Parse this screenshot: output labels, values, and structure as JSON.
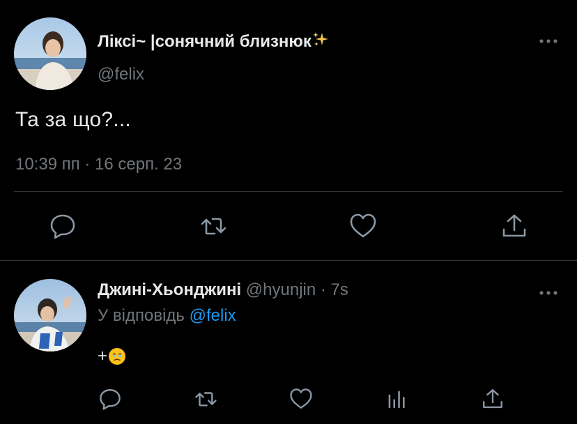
{
  "main_tweet": {
    "author_name": "Ліксі~ |сонячний близнюк",
    "author_name_emoji": "sparkles-icon",
    "handle": "@felix",
    "text": "Та за що?...",
    "timestamp": "10:39 пп · 16 серп. 23",
    "actions": [
      "reply-icon",
      "retweet-icon",
      "like-icon",
      "share-icon"
    ]
  },
  "reply_tweet": {
    "author_name": "Джині-Хьонджині",
    "handle_time": "@hyunjin · 7s",
    "reply_to_prefix": "У відповідь",
    "reply_to_handle": "@felix",
    "text": "+",
    "text_emoji": "face-holding-back-tears-emoji",
    "actions": [
      "reply-icon",
      "retweet-icon",
      "like-icon",
      "analytics-icon",
      "share-icon"
    ]
  },
  "colors": {
    "background": "#000000",
    "primary_text": "#e7e9ea",
    "secondary_text": "#71767b",
    "link": "#1d9bf0",
    "divider": "#2f3336"
  }
}
